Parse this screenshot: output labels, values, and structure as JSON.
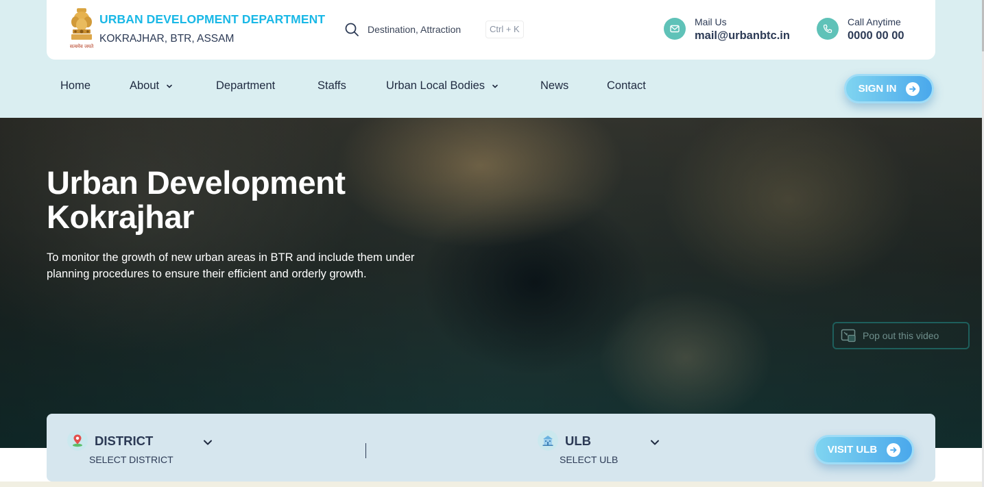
{
  "header": {
    "department_title": "URBAN DEVELOPMENT DEPARTMENT",
    "department_subtitle": "KOKRAJHAR, BTR, ASSAM",
    "emblem_icon": "state-emblem-icon",
    "emblem_caption": "सत्यमेव जयते",
    "search": {
      "placeholder": "Destination, Attraction",
      "shortcut": "Ctrl + K",
      "icon": "search-icon"
    },
    "mail": {
      "label": "Mail Us",
      "value": "mail@urbanbtc.in",
      "icon": "mail-icon"
    },
    "phone": {
      "label": "Call Anytime",
      "value": "0000 00 00",
      "icon": "phone-icon"
    }
  },
  "nav": {
    "items": [
      {
        "label": "Home",
        "has_dropdown": false
      },
      {
        "label": "About",
        "has_dropdown": true
      },
      {
        "label": "Department",
        "has_dropdown": false
      },
      {
        "label": "Staffs",
        "has_dropdown": false
      },
      {
        "label": "Urban Local Bodies",
        "has_dropdown": true
      },
      {
        "label": "News",
        "has_dropdown": false
      },
      {
        "label": "Contact",
        "has_dropdown": false
      }
    ],
    "sign_in_label": "SIGN IN"
  },
  "hero": {
    "title_line1": "Urban Development",
    "title_line2": "Kokrajhar",
    "description": "To monitor the growth of new urban areas in BTR and include them under planning procedures to ensure their efficient and orderly growth.",
    "popout_label": "Pop out this video"
  },
  "filters": {
    "district": {
      "label": "DISTRICT",
      "sub": "SELECT DISTRICT",
      "icon": "map-pin-icon"
    },
    "ulb": {
      "label": "ULB",
      "sub": "SELECT ULB",
      "icon": "building-icon"
    },
    "visit_label": "VISIT ULB"
  },
  "colors": {
    "accent": "#1ab8e6",
    "header_band": "#daeef1",
    "text_dark": "#2c3a55",
    "contact_icon_bg": "#5fc2b8",
    "button_gradient_start": "#7fd4f0",
    "button_gradient_end": "#4aa8ec",
    "filter_bar_bg": "#d6e6ee"
  }
}
